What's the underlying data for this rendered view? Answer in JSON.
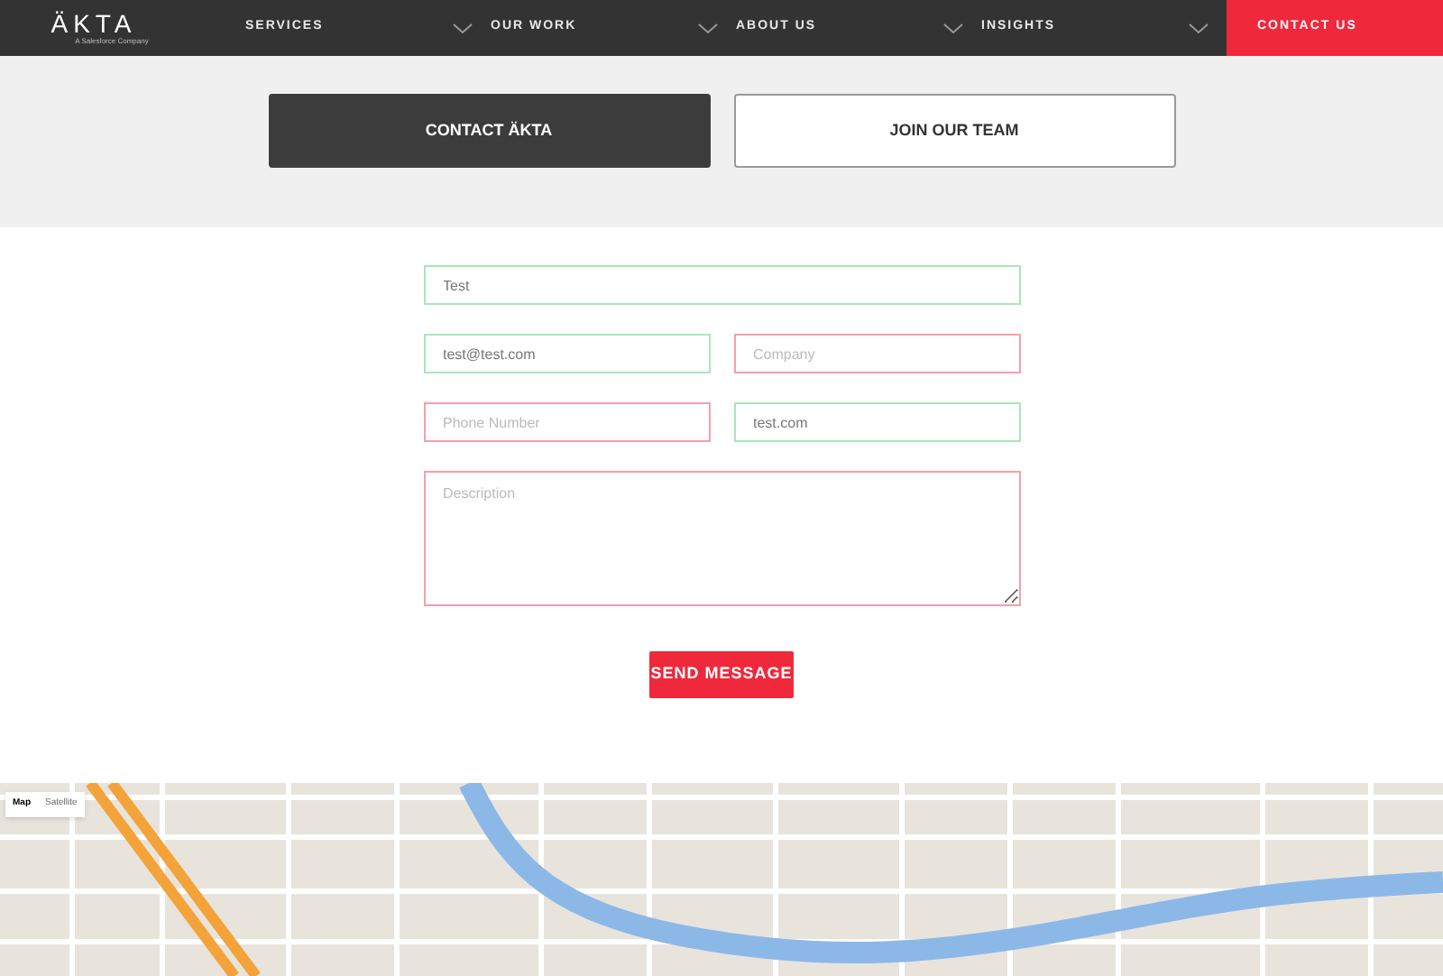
{
  "logo": {
    "wordmark": "ÄKTA",
    "tagline": "A Salesforce Company"
  },
  "nav": [
    {
      "label": "SERVICES",
      "kind": "dropdown"
    },
    {
      "label": "OUR WORK",
      "kind": "dropdown"
    },
    {
      "label": "ABOUT US",
      "kind": "dropdown"
    },
    {
      "label": "INSIGHTS",
      "kind": "dropdown"
    },
    {
      "label": "CONTACT US",
      "kind": "highlight"
    }
  ],
  "tabs": [
    {
      "label": "CONTACT ÄKTA",
      "selected": true
    },
    {
      "label": "JOIN OUR TEAM",
      "selected": false
    }
  ],
  "form": {
    "fields": [
      {
        "value": "Test",
        "valid": true
      },
      {
        "value": "test@test.com",
        "valid": true
      },
      {
        "placeholder": "Company",
        "valid": false
      },
      {
        "placeholder": "Phone Number",
        "valid": false
      },
      {
        "value": "test.com",
        "valid": true
      },
      {
        "placeholder": "Description",
        "valid": false,
        "kind": "textarea"
      }
    ],
    "submit": "SEND MESSAGE"
  },
  "map": {
    "view_options": [
      {
        "label": "Map",
        "selected": true
      },
      {
        "label": "Satellite",
        "selected": false
      }
    ]
  }
}
